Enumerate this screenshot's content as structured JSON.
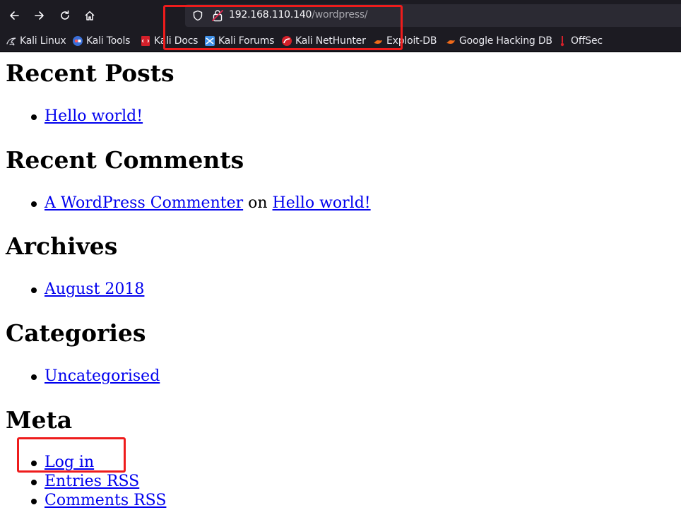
{
  "browser": {
    "url_host": "192.168.110.140",
    "url_path": "/wordpress/",
    "bookmarks": [
      {
        "label": "Kali Linux",
        "icon": "kali-dragon-icon"
      },
      {
        "label": "Kali Tools",
        "icon": "kali-tools-icon"
      },
      {
        "label": "Kali Docs",
        "icon": "kali-docs-icon"
      },
      {
        "label": "Kali Forums",
        "icon": "kali-forums-icon"
      },
      {
        "label": "Kali NetHunter",
        "icon": "kali-nethunter-icon"
      },
      {
        "label": "Exploit-DB",
        "icon": "exploit-db-icon"
      },
      {
        "label": "Google Hacking DB",
        "icon": "ghdb-icon"
      },
      {
        "label": "OffSec",
        "icon": "offsec-icon"
      }
    ]
  },
  "sidebar": {
    "recent_posts": {
      "heading": "Recent Posts",
      "items": [
        "Hello world!"
      ]
    },
    "recent_comments": {
      "heading": "Recent Comments",
      "author": "A WordPress Commenter",
      "on": "on",
      "post": "Hello world!"
    },
    "archives": {
      "heading": "Archives",
      "items": [
        "August 2018"
      ]
    },
    "categories": {
      "heading": "Categories",
      "items": [
        "Uncategorised"
      ]
    },
    "meta": {
      "heading": "Meta",
      "items": [
        "Log in",
        "Entries RSS",
        "Comments RSS"
      ]
    }
  },
  "colors": {
    "annotation": "#ee1c1c",
    "link": "#0000ee",
    "chrome_bg": "#1c1b22"
  }
}
